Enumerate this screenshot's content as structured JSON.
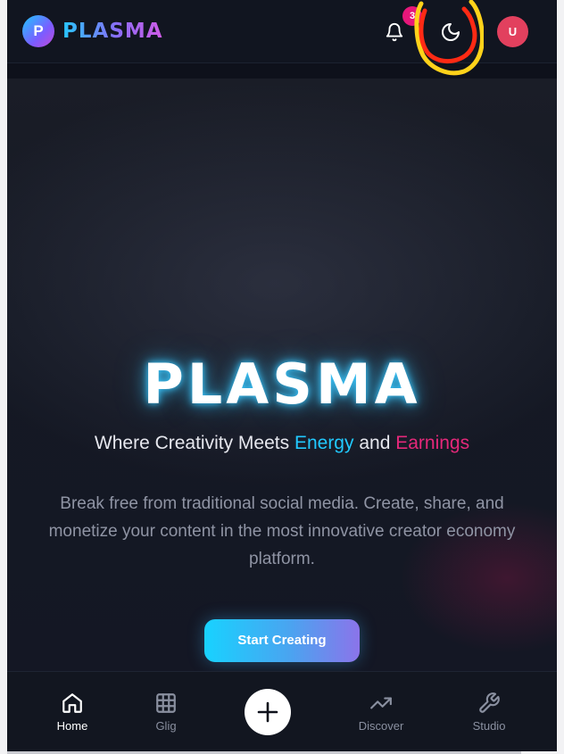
{
  "header": {
    "logo_initial": "P",
    "logo_text": "PLASMA",
    "notification_count": "3",
    "avatar_initial": "U"
  },
  "hero": {
    "title": "PLASMA",
    "tagline_prefix": "Where Creativity Meets ",
    "tagline_energy": "Energy",
    "tagline_and": " and ",
    "tagline_earnings": "Earnings",
    "description": "Break free from traditional social media. Create, share, and monetize your content in the most innovative creator economy platform.",
    "cta_label": "Start Creating"
  },
  "bottom_nav": {
    "items": [
      {
        "label": "Home",
        "icon": "home-icon",
        "active": true
      },
      {
        "label": "Glig",
        "icon": "grid-icon",
        "active": false
      },
      {
        "label": "Discover",
        "icon": "trending-up-icon",
        "active": false
      },
      {
        "label": "Studio",
        "icon": "wrench-icon",
        "active": false
      }
    ],
    "create_icon": "plus-icon"
  },
  "colors": {
    "background": "#0e111b",
    "accent_cyan": "#21c9ff",
    "accent_pink": "#e5287a",
    "badge": "#e6177a",
    "avatar": "#e2405e",
    "annotation_red": "#ff2a14",
    "annotation_yellow": "#ffd21a"
  }
}
